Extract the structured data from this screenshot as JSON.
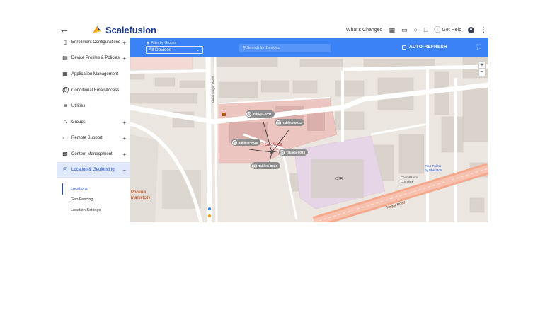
{
  "header": {
    "brand_name": "Scalefusion",
    "whats_changed": "What's Changed",
    "get_help": "Get Help"
  },
  "sidebar": {
    "items": [
      {
        "label": "Enrollment Configurations",
        "icon": "enrollment-icon",
        "expandable": true
      },
      {
        "label": "Device Profiles & Policies",
        "icon": "clipboard-icon",
        "expandable": true
      },
      {
        "label": "Application Management",
        "icon": "apps-grid-icon",
        "expandable": false
      },
      {
        "label": "Conditional Email Access",
        "icon": "at-sign-icon",
        "expandable": false
      },
      {
        "label": "Utilities",
        "icon": "sliders-icon",
        "expandable": false
      },
      {
        "label": "Groups",
        "icon": "groups-icon",
        "expandable": true
      },
      {
        "label": "Remote Support",
        "icon": "cast-icon",
        "expandable": true
      },
      {
        "label": "Content Management",
        "icon": "folder-icon",
        "expandable": true
      },
      {
        "label": "Location & Geofencing",
        "icon": "location-target-icon",
        "expandable": true,
        "expanded": true
      }
    ],
    "subitems": [
      {
        "label": "Locations",
        "current": true
      },
      {
        "label": "Geo Fencing",
        "current": false
      },
      {
        "label": "Location Settings",
        "current": false
      }
    ]
  },
  "toolbar": {
    "filter_label": "Filter by Groups",
    "filter_value": "All Devices",
    "search_placeholder": "Search for Devices",
    "auto_refresh": "AUTO-REFRESH"
  },
  "map": {
    "devices": [
      {
        "label": "Tablets-0031"
      },
      {
        "label": "Tablets-0010"
      },
      {
        "label": "Tablets-0016"
      },
      {
        "label": "Tablets-0023"
      },
      {
        "label": "Tablets-0020"
      }
    ],
    "labels": {
      "road_vertical": "Vimal Nagar Road",
      "center": "Geoforce",
      "building": "CTR",
      "place_1": "Phoenix Marketcity",
      "road_east": "Nagar Road",
      "place_2": "ChandRama Complex",
      "place_3": "Four Points by Sheraton"
    }
  },
  "colors": {
    "accent": "#3b82f6",
    "brand": "#1e3a8a",
    "active_nav_bg": "#e0e9fb"
  }
}
